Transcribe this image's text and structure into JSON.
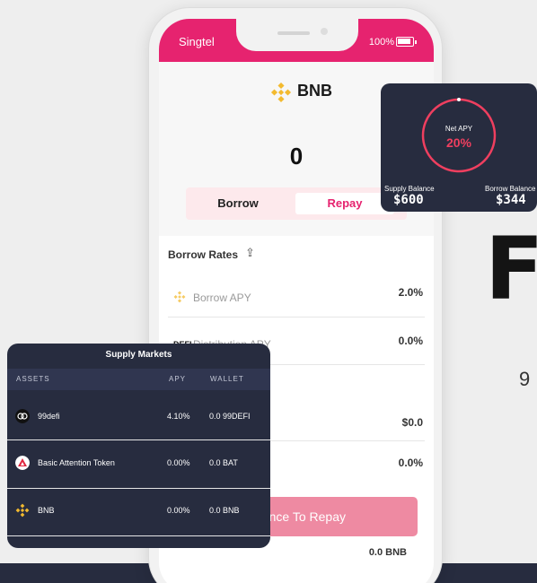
{
  "phone": {
    "carrier": "Singtel",
    "battery": "100%",
    "asset_title": "BNB",
    "close_symbol": "×",
    "amount": "0",
    "tabs": [
      "Borrow",
      "Repay"
    ],
    "active_tab": "Repay",
    "borrow_rates_title": "Borrow Rates",
    "rows": [
      {
        "label": "Borrow APY",
        "value": "2.0%"
      },
      {
        "label": "Distribution APY",
        "value": "0.0%"
      },
      {
        "label": "",
        "value": "$0.0"
      },
      {
        "label": "",
        "value": "0.0%"
      }
    ],
    "repay_button": "lance To Repay",
    "balance": "0.0 BNB",
    "accent": "#e6236f"
  },
  "net_apy_card": {
    "label": "Net APY",
    "value": "20%",
    "supply_label": "Supply Balance",
    "supply_value": "$600",
    "borrow_label": "Borrow Balance",
    "borrow_value": "$344",
    "ring_color": "#ef3f5f"
  },
  "supply_markets": {
    "title": "Supply Markets",
    "columns": [
      "ASSETS",
      "APY",
      "WALLET"
    ],
    "rows": [
      {
        "asset": "99defi",
        "apy": "4.10%",
        "wallet": "0.0 99DEFI",
        "icon": "defi99-icon"
      },
      {
        "asset": "Basic Attention Token",
        "apy": "0.00%",
        "wallet": "0.0 BAT",
        "icon": "bat-icon"
      },
      {
        "asset": "BNB",
        "apy": "0.00%",
        "wallet": "0.0 BNB",
        "icon": "bnb-icon"
      }
    ]
  },
  "background": {
    "big_letter": "F",
    "side_digit": "9"
  }
}
